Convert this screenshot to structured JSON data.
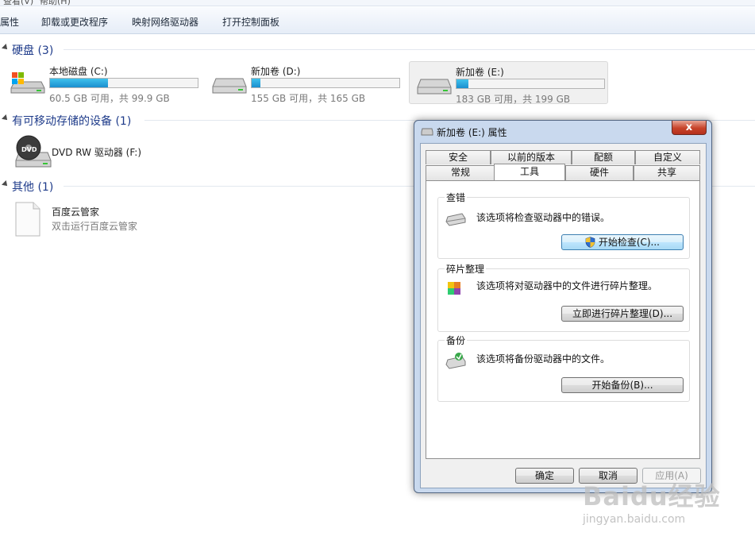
{
  "menu_bar": {
    "items": [
      "查看(V)",
      "帮助(H)"
    ]
  },
  "toolbar": {
    "buttons": [
      "属性",
      "卸载或更改程序",
      "映射网络驱动器",
      "打开控制面板"
    ]
  },
  "groups": {
    "hard_disks": {
      "title": "硬盘 (3)"
    },
    "removable": {
      "title": "有可移动存储的设备 (1)"
    },
    "other": {
      "title": "其他 (1)"
    }
  },
  "drives": [
    {
      "name": "本地磁盘 (C:)",
      "size": "60.5 GB 可用，共 99.9 GB",
      "used_fraction": 0.39
    },
    {
      "name": "新加卷 (D:)",
      "size": "155 GB 可用，共 165 GB",
      "used_fraction": 0.06
    },
    {
      "name": "新加卷 (E:)",
      "size": "183 GB 可用，共 199 GB",
      "used_fraction": 0.08
    }
  ],
  "removable_device": {
    "name": "DVD RW 驱动器 (F:)",
    "icon_label": "DVD"
  },
  "other_item": {
    "name": "百度云管家",
    "desc": "双击运行百度云管家"
  },
  "dialog": {
    "title": "新加卷 (E:) 属性",
    "close": "x",
    "tabs_row1": [
      "安全",
      "以前的版本",
      "配额",
      "自定义"
    ],
    "tabs_row2": [
      "常规",
      "工具",
      "硬件",
      "共享"
    ],
    "active_tab": "工具",
    "sections": {
      "check": {
        "title": "查错",
        "desc": "该选项将检查驱动器中的错误。",
        "button": "开始检查(C)..."
      },
      "defrag": {
        "title": "碎片整理",
        "desc": "该选项将对驱动器中的文件进行碎片整理。",
        "button": "立即进行碎片整理(D)..."
      },
      "backup": {
        "title": "备份",
        "desc": "该选项将备份驱动器中的文件。",
        "button": "开始备份(B)..."
      }
    },
    "ok": "确定",
    "cancel": "取消",
    "apply": "应用(A)"
  },
  "watermark": {
    "brand": "Baidu经验",
    "url": "jingyan.baidu.com"
  },
  "colors": {
    "highlight": "#e2262b",
    "group_title": "#1e3b8a",
    "bar_fill": "#1a8fcf"
  }
}
